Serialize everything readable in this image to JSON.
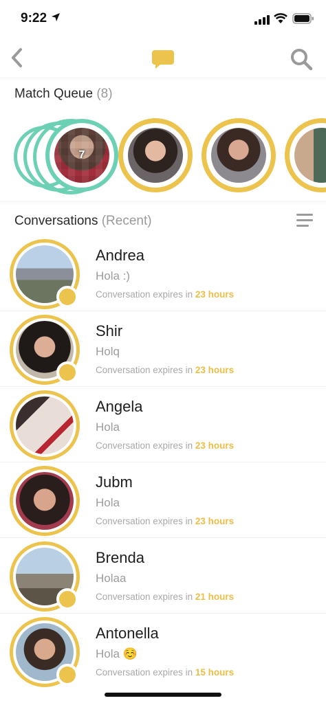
{
  "status": {
    "time": "9:22"
  },
  "nav": {
    "back_icon": "chevron-left-icon",
    "center_icon": "chat-bubble-icon",
    "search_icon": "search-icon",
    "accent": "#ECC34C"
  },
  "queue": {
    "title": "Match Queue",
    "count": "(8)",
    "stack_badge": "7"
  },
  "conversations": {
    "title": "Conversations",
    "subtitle": "(Recent)",
    "expires_prefix": "Conversation expires in",
    "items": [
      {
        "name": "Andrea",
        "message": "Hola :)",
        "expires": "23 hours"
      },
      {
        "name": "Shir",
        "message": "Holq",
        "expires": "23 hours"
      },
      {
        "name": "Angela",
        "message": "Hola",
        "expires": "23 hours"
      },
      {
        "name": "Jubm",
        "message": "Hola",
        "expires": "23 hours"
      },
      {
        "name": "Brenda",
        "message": "Holaa",
        "expires": "21 hours"
      },
      {
        "name": "Antonella",
        "message": "Hola ☺️",
        "expires": "15 hours"
      }
    ]
  }
}
